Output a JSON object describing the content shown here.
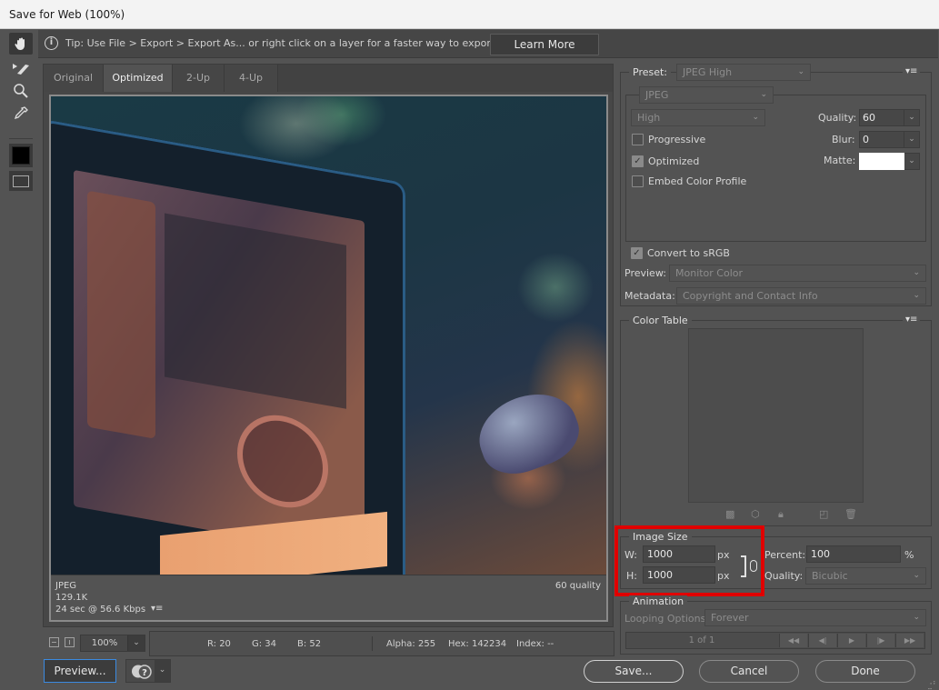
{
  "window": {
    "title": "Save for Web (100%)"
  },
  "toolbar": {
    "tools": [
      {
        "name": "hand-tool",
        "glyph": "✋"
      },
      {
        "name": "slice-select-tool",
        "glyph": "➤"
      },
      {
        "name": "zoom-tool",
        "glyph": "🔍"
      },
      {
        "name": "eyedropper-tool",
        "glyph": "✎"
      }
    ],
    "eyedropper_color": "#000000"
  },
  "tip": {
    "icon": "info-icon",
    "text": "Tip: Use File > Export > Export As...  or right click on a layer for a faster way to export assets",
    "learn_more_label": "Learn More"
  },
  "preview": {
    "tabs": [
      {
        "label": "Original",
        "active": false
      },
      {
        "label": "Optimized",
        "active": true
      },
      {
        "label": "2-Up",
        "active": false
      },
      {
        "label": "4-Up",
        "active": false
      }
    ],
    "info": {
      "format": "JPEG",
      "file_size": "129.1K",
      "download_time": "24 sec @ 56.6 Kbps",
      "menu_glyph": "▾≡",
      "quality": "60 quality"
    }
  },
  "status": {
    "zoom": "100%",
    "r": "R: 20",
    "g": "G: 34",
    "b": "B: 52",
    "alpha": "Alpha: 255",
    "hex": "Hex: 142234",
    "index": "Index: --"
  },
  "bottom": {
    "preview_label": "Preview...",
    "save_label": "Save...",
    "cancel_label": "Cancel",
    "done_label": "Done"
  },
  "settings": {
    "preset_label": "Preset:",
    "preset_value": "JPEG High",
    "format_value": "JPEG",
    "quality_level": "High",
    "quality_label": "Quality:",
    "quality_value": "60",
    "blur_label": "Blur:",
    "blur_value": "0",
    "matte_label": "Matte:",
    "matte_color": "#ffffff",
    "progressive_label": "Progressive",
    "progressive_checked": false,
    "optimized_label": "Optimized",
    "optimized_checked": true,
    "embed_profile_label": "Embed Color Profile",
    "embed_profile_checked": false,
    "convert_srgb_label": "Convert to sRGB",
    "convert_srgb_checked": true,
    "preview_label": "Preview:",
    "preview_value": "Monitor Color",
    "metadata_label": "Metadata:",
    "metadata_value": "Copyright and Contact Info"
  },
  "color_table": {
    "title": "Color Table",
    "icons": [
      "transparency-icon",
      "web-snap-icon",
      "lock-icon",
      "new-color-icon",
      "trash-icon"
    ]
  },
  "image_size": {
    "title": "Image Size",
    "w_label": "W:",
    "w_value": "1000",
    "h_label": "H:",
    "h_value": "1000",
    "unit": "px",
    "percent_label": "Percent:",
    "percent_value": "100",
    "percent_unit": "%",
    "quality_label": "Quality:",
    "quality_value": "Bicubic",
    "highlight_color": "#e00000"
  },
  "animation": {
    "title": "Animation",
    "looping_label": "Looping Options:",
    "looping_value": "Forever",
    "frame_count": "1 of 1"
  }
}
